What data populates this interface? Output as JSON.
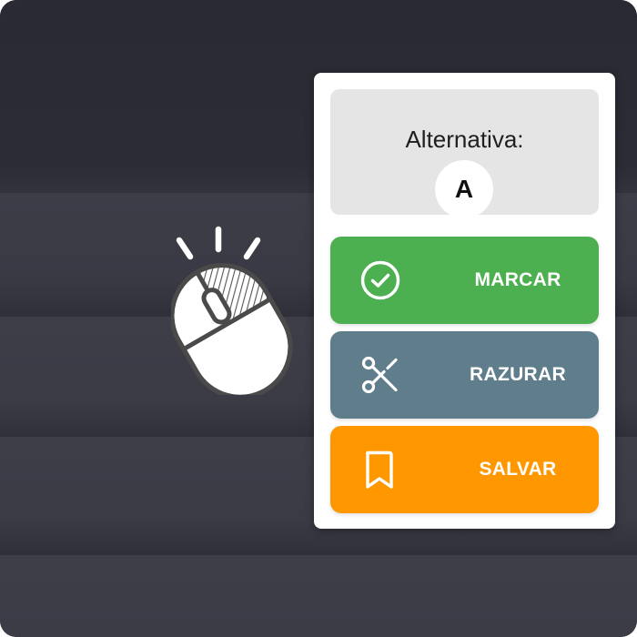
{
  "alternative_card": {
    "label": "Alternativa:",
    "selected_option": "A"
  },
  "actions": [
    {
      "label": "MARCAR",
      "icon": "check-circle-icon",
      "color": "#4caf50"
    },
    {
      "label": "RAZURAR",
      "icon": "scissors-icon",
      "color": "#607d8b"
    },
    {
      "label": "SALVAR",
      "icon": "bookmark-icon",
      "color": "#ff9800"
    }
  ],
  "illustration": {
    "icon": "mouse-click-icon"
  },
  "colors": {
    "background": "#34343f",
    "panel": "#ffffff",
    "alt_box": "#e5e5e5"
  }
}
